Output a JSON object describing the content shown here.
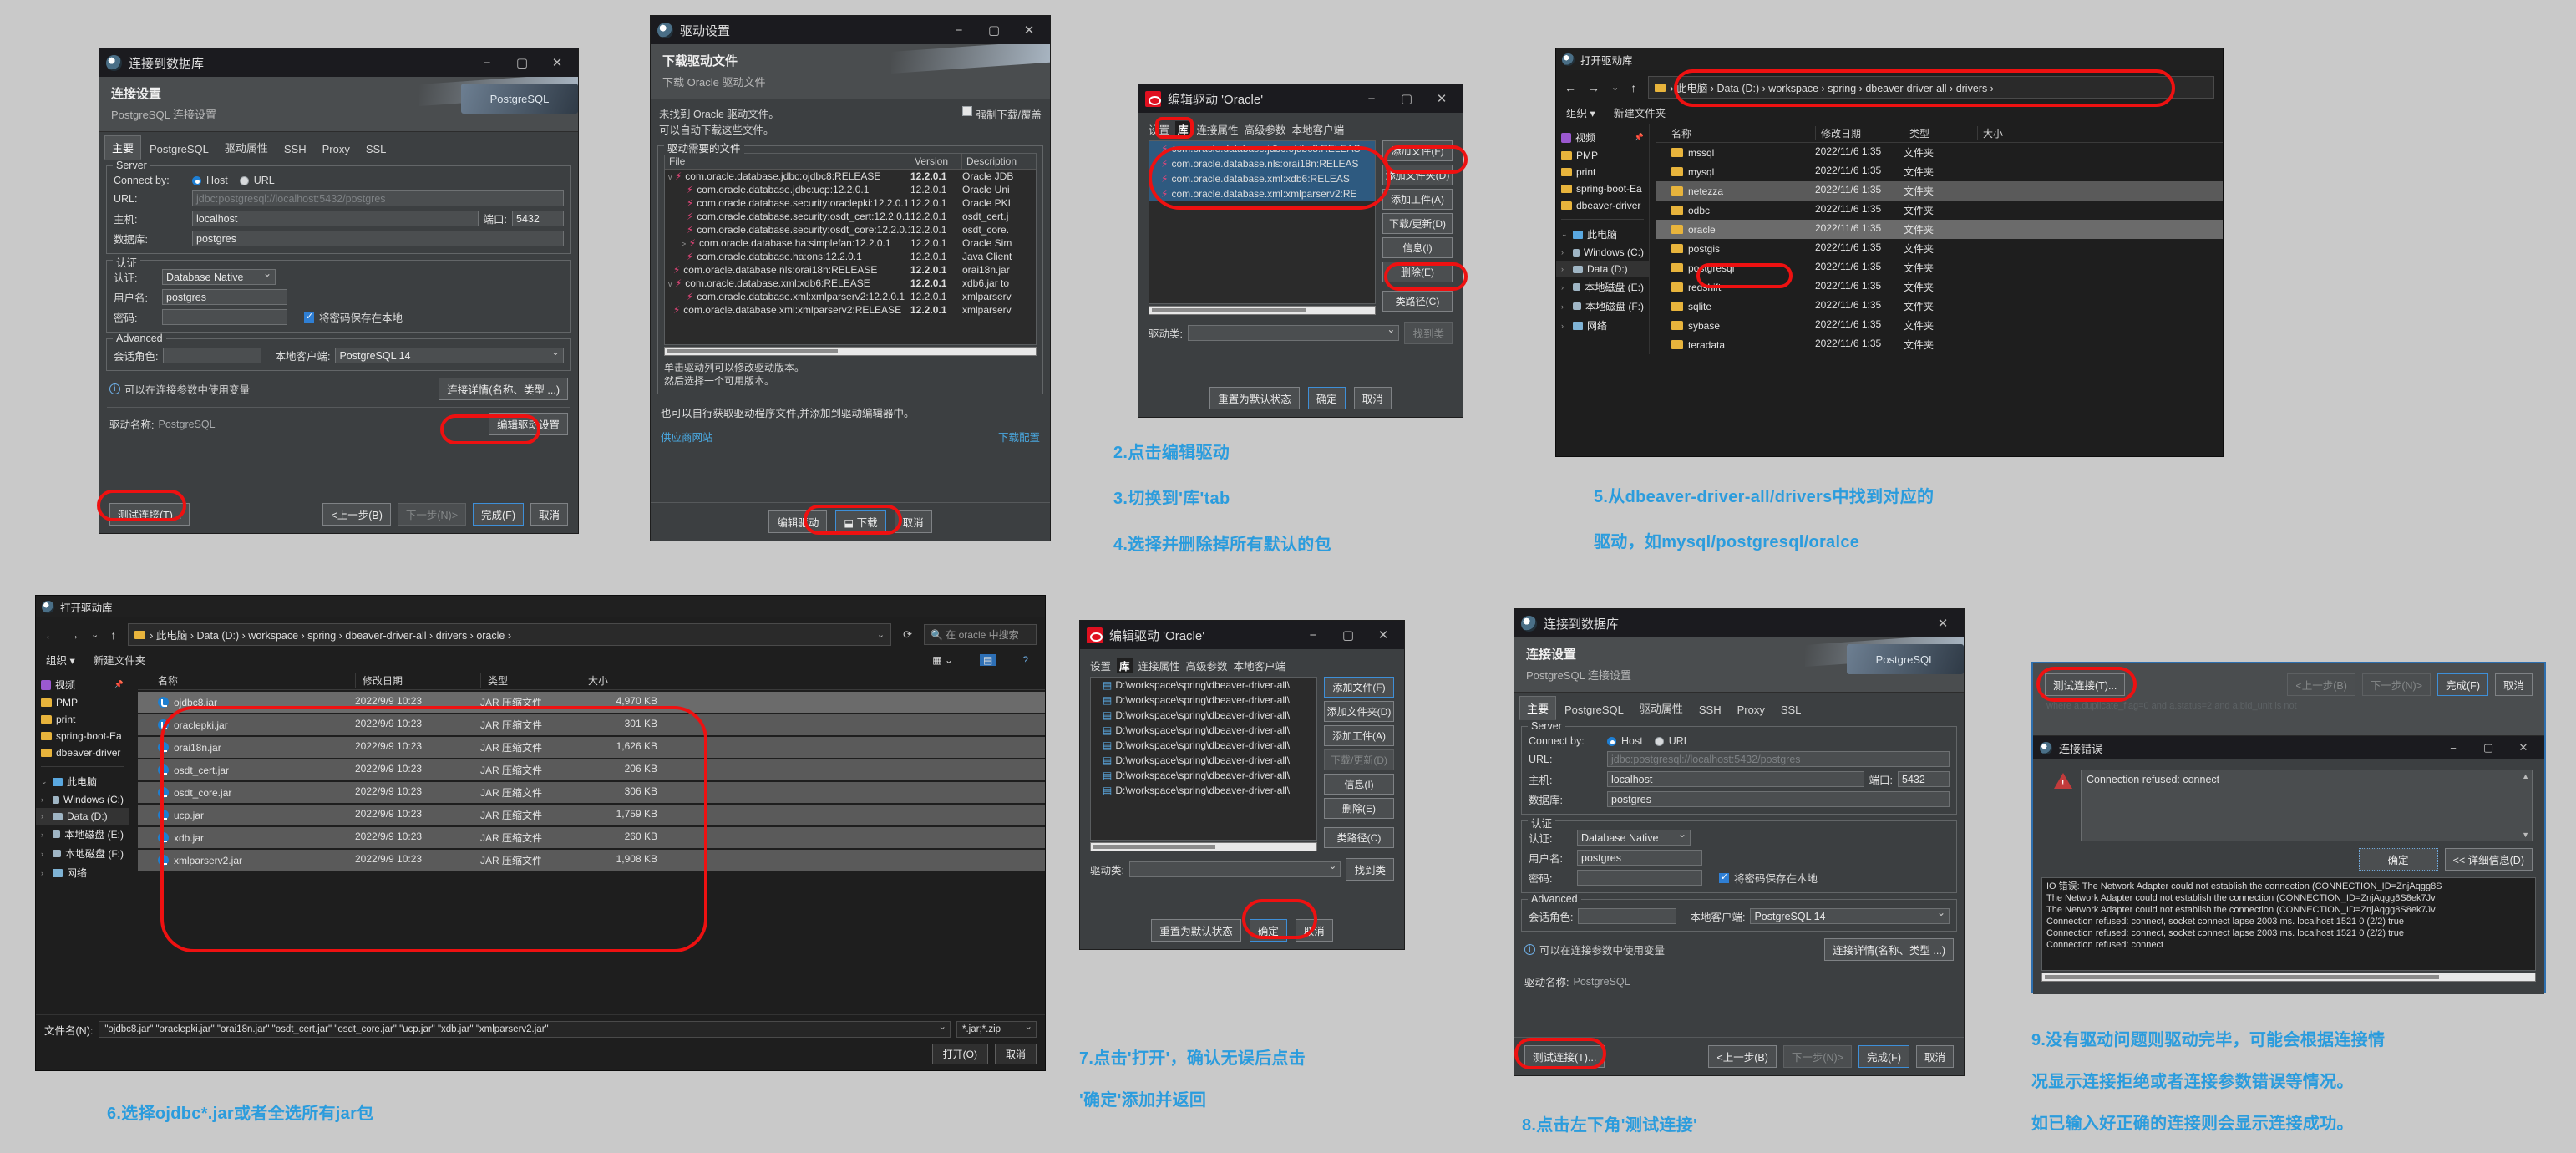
{
  "conn_dialog": {
    "title": "连接到数据库",
    "header_title": "连接设置",
    "header_sub": "PostgreSQL 连接设置",
    "page_badge": "PostgreSQL",
    "tabs": [
      "主要",
      "PostgreSQL",
      "驱动属性",
      "SSH",
      "Proxy",
      "SSL"
    ],
    "server_group": "Server",
    "connect_by_label": "Connect by:",
    "host_radio": "Host",
    "url_radio": "URL",
    "url_label": "URL:",
    "url_placeholder": "jdbc:postgresql://localhost:5432/postgres",
    "host_label": "主机:",
    "host_value": "localhost",
    "port_label": "端口:",
    "port_value": "5432",
    "db_label": "数据库:",
    "db_value": "postgres",
    "auth_group": "认证",
    "auth_label": "认证:",
    "auth_value": "Database Native",
    "user_label": "用户名:",
    "user_value": "postgres",
    "pwd_label": "密码:",
    "pwd_value": "",
    "save_pwd": "将密码保存在本地",
    "advanced_group": "Advanced",
    "session_role_label": "会话角色:",
    "session_role_value": "",
    "local_client_label": "本地客户端:",
    "local_client_value": "PostgreSQL 14",
    "var_hint": "可以在连接参数中使用变量",
    "conn_details_btn": "连接详情(名称、类型 ...)",
    "driver_name_label": "驱动名称:",
    "driver_name_value": "PostgreSQL",
    "edit_driver_settings_btn": "编辑驱动设置",
    "test_btn": "测试连接(T)...",
    "back_btn": "<上一步(B)",
    "next_btn": "下一步(N)>",
    "finish_btn": "完成(F)",
    "cancel_btn": "取消"
  },
  "driver_settings": {
    "title": "驱动设置",
    "header_title": "下载驱动文件",
    "header_sub": "下载 Oracle 驱动文件",
    "msg_line1": "未找到 Oracle 驱动文件。",
    "msg_line2": "可以自动下载这些文件。",
    "force_download": "强制下载/覆盖",
    "files_group": "驱动需要的文件",
    "columns": [
      "File",
      "Version",
      "Description"
    ],
    "rows": [
      {
        "file": "com.oracle.database.jdbc:ojdbc8:RELEASE",
        "version": "12.2.0.1",
        "desc": "Oracle JDB",
        "indent": 0,
        "bold": true,
        "twisty": "v"
      },
      {
        "file": "com.oracle.database.jdbc:ucp:12.2.0.1",
        "version": "12.2.0.1",
        "desc": "Oracle Uni",
        "indent": 1,
        "bold": false,
        "twisty": ""
      },
      {
        "file": "com.oracle.database.security:oraclepki:12.2.0.1",
        "version": "12.2.0.1",
        "desc": "Oracle PKI",
        "indent": 1,
        "bold": false,
        "twisty": ""
      },
      {
        "file": "com.oracle.database.security:osdt_cert:12.2.0.1",
        "version": "12.2.0.1",
        "desc": "osdt_cert.j",
        "indent": 1,
        "bold": false,
        "twisty": ""
      },
      {
        "file": "com.oracle.database.security:osdt_core:12.2.0.1",
        "version": "12.2.0.1",
        "desc": "osdt_core.",
        "indent": 1,
        "bold": false,
        "twisty": ""
      },
      {
        "file": "com.oracle.database.ha:simplefan:12.2.0.1",
        "version": "12.2.0.1",
        "desc": "Oracle Sim",
        "indent": 1,
        "bold": false,
        "twisty": ">"
      },
      {
        "file": "com.oracle.database.ha:ons:12.2.0.1",
        "version": "12.2.0.1",
        "desc": "Java Client",
        "indent": 1,
        "bold": false,
        "twisty": ""
      },
      {
        "file": "com.oracle.database.nls:orai18n:RELEASE",
        "version": "12.2.0.1",
        "desc": "orai18n.jar",
        "indent": 0,
        "bold": true,
        "twisty": ""
      },
      {
        "file": "com.oracle.database.xml:xdb6:RELEASE",
        "version": "12.2.0.1",
        "desc": "xdb6.jar to",
        "indent": 0,
        "bold": true,
        "twisty": "v"
      },
      {
        "file": "com.oracle.database.xml:xmlparserv2:12.2.0.1",
        "version": "12.2.0.1",
        "desc": "xmlparserv",
        "indent": 1,
        "bold": false,
        "twisty": ""
      },
      {
        "file": "com.oracle.database.xml:xmlparserv2:RELEASE",
        "version": "12.2.0.1",
        "desc": "xmlparserv",
        "indent": 0,
        "bold": true,
        "twisty": ""
      }
    ],
    "hint1": "单击驱动列可以修改驱动版本。",
    "hint2": "然后选择一个可用版本。",
    "hint3": "也可以自行获取驱动程序文件,并添加到驱动编辑器中。",
    "link_vendor": "供应商网站",
    "link_config": "下载配置",
    "edit_driver_btn": "编辑驱动",
    "download_btn": "下载",
    "cancel_btn": "取消"
  },
  "edit_driver_top": {
    "title": "编辑驱动 'Oracle'",
    "tabs": [
      "设置",
      "库",
      "连接属性",
      "高级参数",
      "本地客户端"
    ],
    "active_tab": "库",
    "libs": [
      "com.oracle.database.jdbc:ojdbc8:RELEAS",
      "com.oracle.database.nls:orai18n:RELEAS",
      "com.oracle.database.xml:xdb6:RELEAS",
      "com.oracle.database.xml:xmlparserv2:RE"
    ],
    "buttons": [
      "添加文件(F)",
      "添加文件夹(D)",
      "添加工件(A)",
      "下载/更新(D)",
      "信息(I)",
      "删除(E)",
      "类路径(C)"
    ],
    "driver_class_label": "驱动类:",
    "driver_class_value": "",
    "find_class_btn": "找到类",
    "reset_btn": "重置为默认状态",
    "ok_btn": "确定",
    "cancel_btn": "取消"
  },
  "open_driver_lib_top": {
    "title": "打开驱动库",
    "breadcrumb": [
      "此电脑",
      "Data (D:)",
      "workspace",
      "spring",
      "dbeaver-driver-all",
      "drivers"
    ],
    "organize": "组织 ▾",
    "new_folder": "新建文件夹",
    "columns": [
      "名称",
      "修改日期",
      "类型",
      "大小"
    ],
    "sidebar": [
      "视频",
      "PMP",
      "print",
      "spring-boot-Ea",
      "dbeaver-driver",
      "此电脑",
      "Windows (C:)",
      "Data (D:)",
      "本地磁盘 (E:)",
      "本地磁盘 (F:)",
      "网络"
    ],
    "rows": [
      {
        "name": "mssql",
        "date": "2022/11/6 1:35",
        "type": "文件夹",
        "size": ""
      },
      {
        "name": "mysql",
        "date": "2022/11/6 1:35",
        "type": "文件夹",
        "size": ""
      },
      {
        "name": "netezza",
        "date": "2022/11/6 1:35",
        "type": "文件夹",
        "size": ""
      },
      {
        "name": "odbc",
        "date": "2022/11/6 1:35",
        "type": "文件夹",
        "size": ""
      },
      {
        "name": "oracle",
        "date": "2022/11/6 1:35",
        "type": "文件夹",
        "size": ""
      },
      {
        "name": "postgis",
        "date": "2022/11/6 1:35",
        "type": "文件夹",
        "size": ""
      },
      {
        "name": "postgresql",
        "date": "2022/11/6 1:35",
        "type": "文件夹",
        "size": ""
      },
      {
        "name": "redshift",
        "date": "2022/11/6 1:35",
        "type": "文件夹",
        "size": ""
      },
      {
        "name": "sqlite",
        "date": "2022/11/6 1:35",
        "type": "文件夹",
        "size": ""
      },
      {
        "name": "sybase",
        "date": "2022/11/6 1:35",
        "type": "文件夹",
        "size": ""
      },
      {
        "name": "teradata",
        "date": "2022/11/6 1:35",
        "type": "文件夹",
        "size": ""
      }
    ]
  },
  "open_driver_lib_bottom": {
    "title": "打开驱动库",
    "breadcrumb": [
      "此电脑",
      "Data (D:)",
      "workspace",
      "spring",
      "dbeaver-driver-all",
      "drivers",
      "oracle"
    ],
    "search_placeholder": "在 oracle 中搜索",
    "organize": "组织 ▾",
    "new_folder": "新建文件夹",
    "columns": [
      "名称",
      "修改日期",
      "类型",
      "大小"
    ],
    "sidebar": [
      "视频",
      "PMP",
      "print",
      "spring-boot-Ea",
      "dbeaver-driver",
      "此电脑",
      "Windows (C:)",
      "Data (D:)",
      "本地磁盘 (E:)",
      "本地磁盘 (F:)",
      "网络"
    ],
    "rows": [
      {
        "name": "ojdbc8.jar",
        "date": "2022/9/9 10:23",
        "type": "JAR 压缩文件",
        "size": "4,970 KB"
      },
      {
        "name": "oraclepki.jar",
        "date": "2022/9/9 10:23",
        "type": "JAR 压缩文件",
        "size": "301 KB"
      },
      {
        "name": "orai18n.jar",
        "date": "2022/9/9 10:23",
        "type": "JAR 压缩文件",
        "size": "1,626 KB"
      },
      {
        "name": "osdt_cert.jar",
        "date": "2022/9/9 10:23",
        "type": "JAR 压缩文件",
        "size": "206 KB"
      },
      {
        "name": "osdt_core.jar",
        "date": "2022/9/9 10:23",
        "type": "JAR 压缩文件",
        "size": "306 KB"
      },
      {
        "name": "ucp.jar",
        "date": "2022/9/9 10:23",
        "type": "JAR 压缩文件",
        "size": "1,759 KB"
      },
      {
        "name": "xdb.jar",
        "date": "2022/9/9 10:23",
        "type": "JAR 压缩文件",
        "size": "260 KB"
      },
      {
        "name": "xmlparserv2.jar",
        "date": "2022/9/9 10:23",
        "type": "JAR 压缩文件",
        "size": "1,908 KB"
      }
    ],
    "filename_label": "文件名(N):",
    "filename_value": "\"ojdbc8.jar\" \"oraclepki.jar\" \"orai18n.jar\" \"osdt_cert.jar\" \"osdt_core.jar\" \"ucp.jar\" \"xdb.jar\" \"xmlparserv2.jar\"",
    "filter_value": "*.jar;*.zip",
    "open_btn": "打开(O)",
    "cancel_btn": "取消"
  },
  "edit_driver_bottom": {
    "title": "编辑驱动 'Oracle'",
    "tabs": [
      "设置",
      "库",
      "连接属性",
      "高级参数",
      "本地客户端"
    ],
    "active_tab": "库",
    "libs": [
      "D:\\workspace\\spring\\dbeaver-driver-all\\",
      "D:\\workspace\\spring\\dbeaver-driver-all\\",
      "D:\\workspace\\spring\\dbeaver-driver-all\\",
      "D:\\workspace\\spring\\dbeaver-driver-all\\",
      "D:\\workspace\\spring\\dbeaver-driver-all\\",
      "D:\\workspace\\spring\\dbeaver-driver-all\\",
      "D:\\workspace\\spring\\dbeaver-driver-all\\",
      "D:\\workspace\\spring\\dbeaver-driver-all\\"
    ],
    "buttons": [
      "添加文件(F)",
      "添加文件夹(D)",
      "添加工件(A)",
      "下载/更新(D)",
      "信息(I)",
      "删除(E)",
      "类路径(C)"
    ],
    "driver_class_label": "驱动类:",
    "driver_class_value": "",
    "find_class_btn": "找到类",
    "reset_btn": "重置为默认状态",
    "ok_btn": "确定",
    "cancel_btn": "取消"
  },
  "conn_dialog2": {
    "title": "连接到数据库",
    "header_title": "连接设置",
    "header_sub": "PostgreSQL 连接设置",
    "page_badge": "PostgreSQL",
    "tabs": [
      "主要",
      "PostgreSQL",
      "驱动属性",
      "SSH",
      "Proxy",
      "SSL"
    ],
    "server_group": "Server",
    "connect_by_label": "Connect by:",
    "host_radio": "Host",
    "url_radio": "URL",
    "url_label": "URL:",
    "url_placeholder": "jdbc:postgresql://localhost:5432/postgres",
    "host_label": "主机:",
    "host_value": "localhost",
    "port_label": "端口:",
    "port_value": "5432",
    "db_label": "数据库:",
    "db_value": "postgres",
    "auth_group": "认证",
    "auth_label": "认证:",
    "auth_value": "Database Native",
    "user_label": "用户名:",
    "user_value": "postgres",
    "pwd_label": "密码:",
    "save_pwd": "将密码保存在本地",
    "advanced_group": "Advanced",
    "session_role_label": "会话角色:",
    "local_client_label": "本地客户端:",
    "local_client_value": "PostgreSQL 14",
    "var_hint": "可以在连接参数中使用变量",
    "conn_details_btn": "连接详情(名称、类型 ...)",
    "driver_name_label": "驱动名称:",
    "driver_name_value": "PostgreSQL",
    "test_btn": "测试连接(T)...",
    "back_btn": "<上一步(B)",
    "next_btn": "下一步(N)>",
    "finish_btn": "完成(F)",
    "cancel_btn": "取消"
  },
  "error_panel": {
    "wizard_test_btn": "测试连接(T)...",
    "wizard_back_btn": "<上一步(B)",
    "wizard_next_btn": "下一步(N)>",
    "wizard_finish_btn": "完成(F)",
    "wizard_cancel_btn": "取消",
    "bg_text": "where a.duplicate_flag=0 and a.status=2 and a.bid_unit is not",
    "title": "连接错误",
    "message": "Connection refused: connect",
    "ok_btn": "确定",
    "details_btn": "<< 详细信息(D)",
    "log_lines": [
      "IO 错误: The Network Adapter could not establish the connection (CONNECTION_ID=ZnjAqgg8S",
      "  The Network Adapter could not establish the connection (CONNECTION_ID=ZnjAqgg8S8ek7Jv",
      "  The Network Adapter could not establish the connection (CONNECTION_ID=ZnjAqgg8S8ek7Jv",
      "   Connection refused: connect, socket connect lapse 2003 ms. localhost 1521  0 (2/2) true",
      "   Connection refused: connect, socket connect lapse 2003 ms. localhost 1521  0 (2/2) true",
      "    Connection refused: connect"
    ]
  },
  "captions": {
    "c2": "2.点击编辑驱动",
    "c3": "3.切换到'库'tab",
    "c4": "4.选择并删除掉所有默认的包",
    "c5a": "5.从dbeaver-driver-all/drivers中找到对应的",
    "c5b": "驱动，如mysql/postgresql/oralce",
    "c6": "6.选择ojdbc*.jar或者全选所有jar包",
    "c7a": "7.点击'打开'，确认无误后点击",
    "c7b": "'确定'添加并返回",
    "c8": "8.点击左下角'测试连接'",
    "c9a": "9.没有驱动问题则驱动完毕，可能会根据连接情",
    "c9b": "况显示连接拒绝或者连接参数错误等情况。",
    "c9c": "如已输入好正确的连接则会显示连接成功。"
  },
  "colors": {
    "accent": "#2b9cdd",
    "highlight": "#ee1111",
    "link": "#4aa8e0"
  }
}
